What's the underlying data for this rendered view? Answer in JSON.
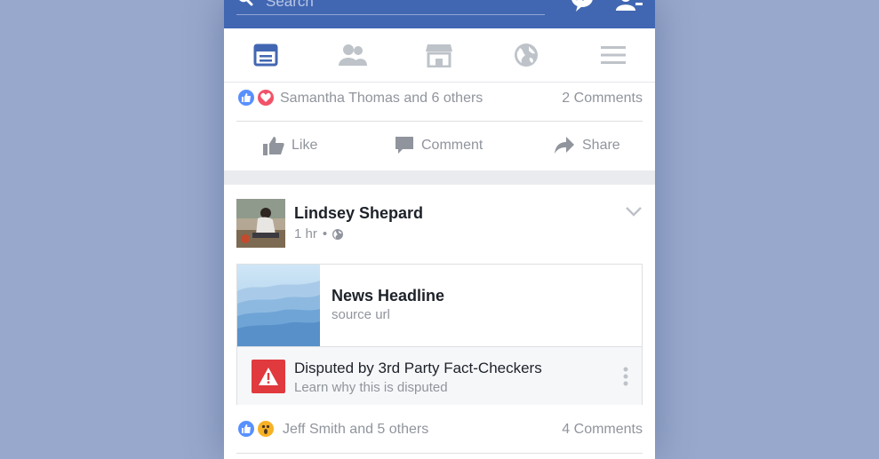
{
  "topbar": {
    "search_placeholder": "Search"
  },
  "nav": {
    "tabs": [
      "news-feed",
      "friends",
      "marketplace",
      "notifications",
      "menu"
    ]
  },
  "post1": {
    "reactions": [
      "like",
      "love"
    ],
    "reactors": "Samantha Thomas and 6 others",
    "comments": "2 Comments",
    "actions": {
      "like": "Like",
      "comment": "Comment",
      "share": "Share"
    }
  },
  "post2": {
    "author": "Lindsey Shepard",
    "time": "1 hr",
    "privacy_separator": "•",
    "link": {
      "headline": "News Headline",
      "source": "source url"
    },
    "dispute": {
      "title": "Disputed by 3rd Party Fact-Checkers",
      "subtitle": "Learn why this is disputed"
    },
    "reactions": [
      "like",
      "wow"
    ],
    "reactors": "Jeff Smith and 5 others",
    "comments": "4 Comments"
  },
  "colors": {
    "brand": "#4267b2",
    "background": "#98a8cc",
    "warning": "#e0393e",
    "like": "#5890ff",
    "love": "#f25268",
    "wow": "#f7b125"
  }
}
